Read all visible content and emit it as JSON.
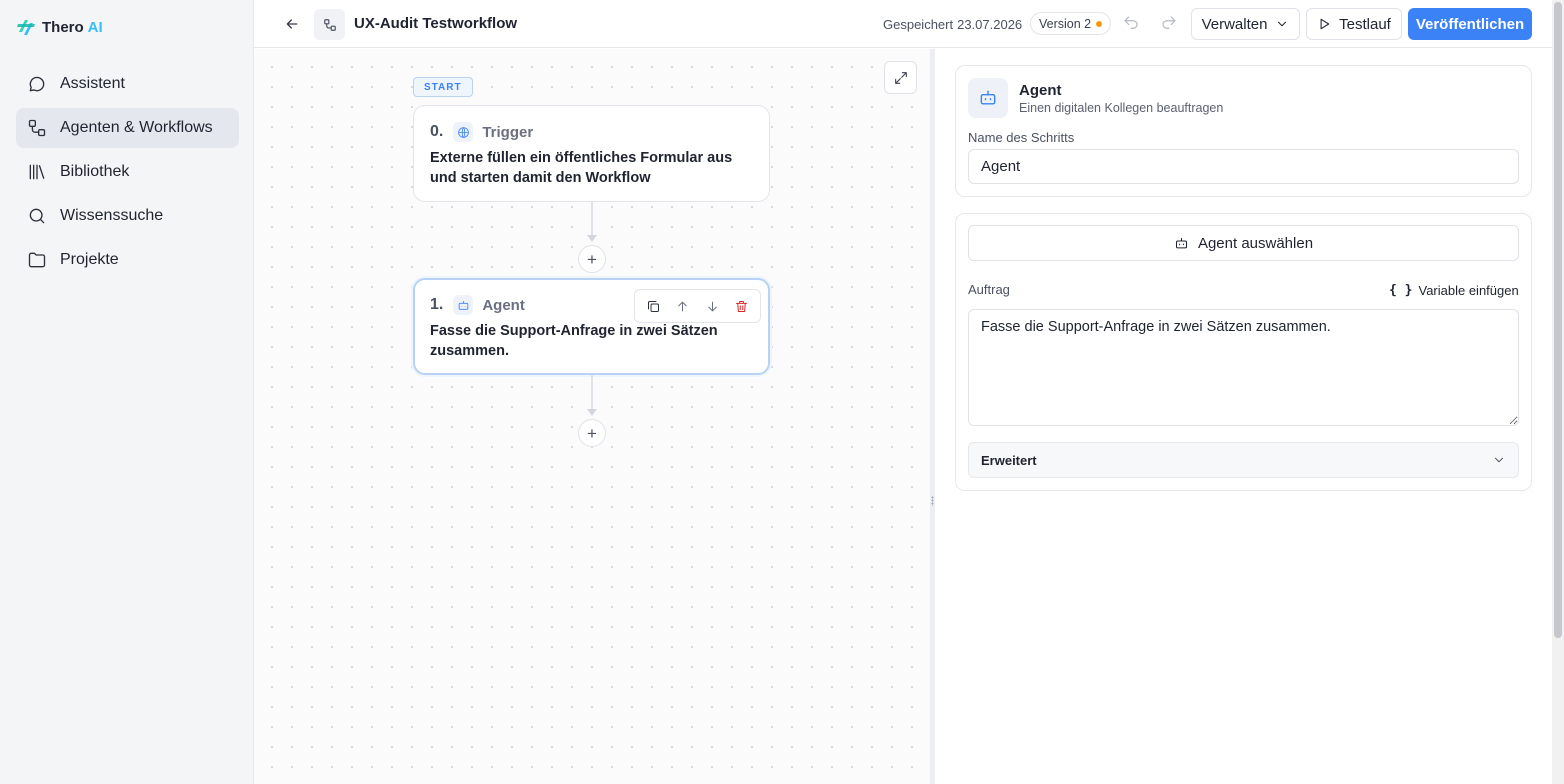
{
  "app": {
    "brand_part1": "Thero",
    "brand_part2": "AI"
  },
  "sidebar": {
    "items": [
      {
        "label": "Assistent",
        "icon": "chat-bubble-icon",
        "active": false
      },
      {
        "label": "Agenten & Workflows",
        "icon": "workflow-icon",
        "active": true
      },
      {
        "label": "Bibliothek",
        "icon": "library-icon",
        "active": false
      },
      {
        "label": "Wissenssuche",
        "icon": "search-icon",
        "active": false
      },
      {
        "label": "Projekte",
        "icon": "folder-icon",
        "active": false
      }
    ]
  },
  "header": {
    "title": "UX-Audit Testworkflow",
    "saved_label": "Gespeichert",
    "saved_date": "23.07.2026",
    "version_label": "Version 2",
    "manage_label": "Verwalten",
    "test_label": "Testlauf",
    "publish_label": "Veröffentlichen"
  },
  "canvas": {
    "start_label": "START",
    "nodes": [
      {
        "number": "0.",
        "kind": "Trigger",
        "icon": "globe-icon",
        "description": "Externe füllen ein öffentliches Formular aus und starten damit den Workflow"
      },
      {
        "number": "1.",
        "kind": "Agent",
        "icon": "robot-icon",
        "description": "Fasse die Support-Anfrage in zwei Sätzen zusammen.",
        "selected": true
      }
    ],
    "add_symbol": "+"
  },
  "panel": {
    "title": "Agent",
    "subtitle": "Einen digitalen Kollegen beauftragen",
    "name_label": "Name des Schritts",
    "name_value": "Agent",
    "choose_agent_label": "Agent auswählen",
    "task_label": "Auftrag",
    "insert_variable_label": "Variable einfügen",
    "variable_symbol": "{ }",
    "task_value": "Fasse die Support-Anfrage in zwei Sätzen zusammen.",
    "advanced_label": "Erweitert"
  },
  "colors": {
    "accent": "#3b82f6",
    "version_dot": "#f59e0b",
    "delete": "#dc2626",
    "sidebar_bg": "#f4f5f7",
    "active_item_bg": "#e4e7ee"
  }
}
